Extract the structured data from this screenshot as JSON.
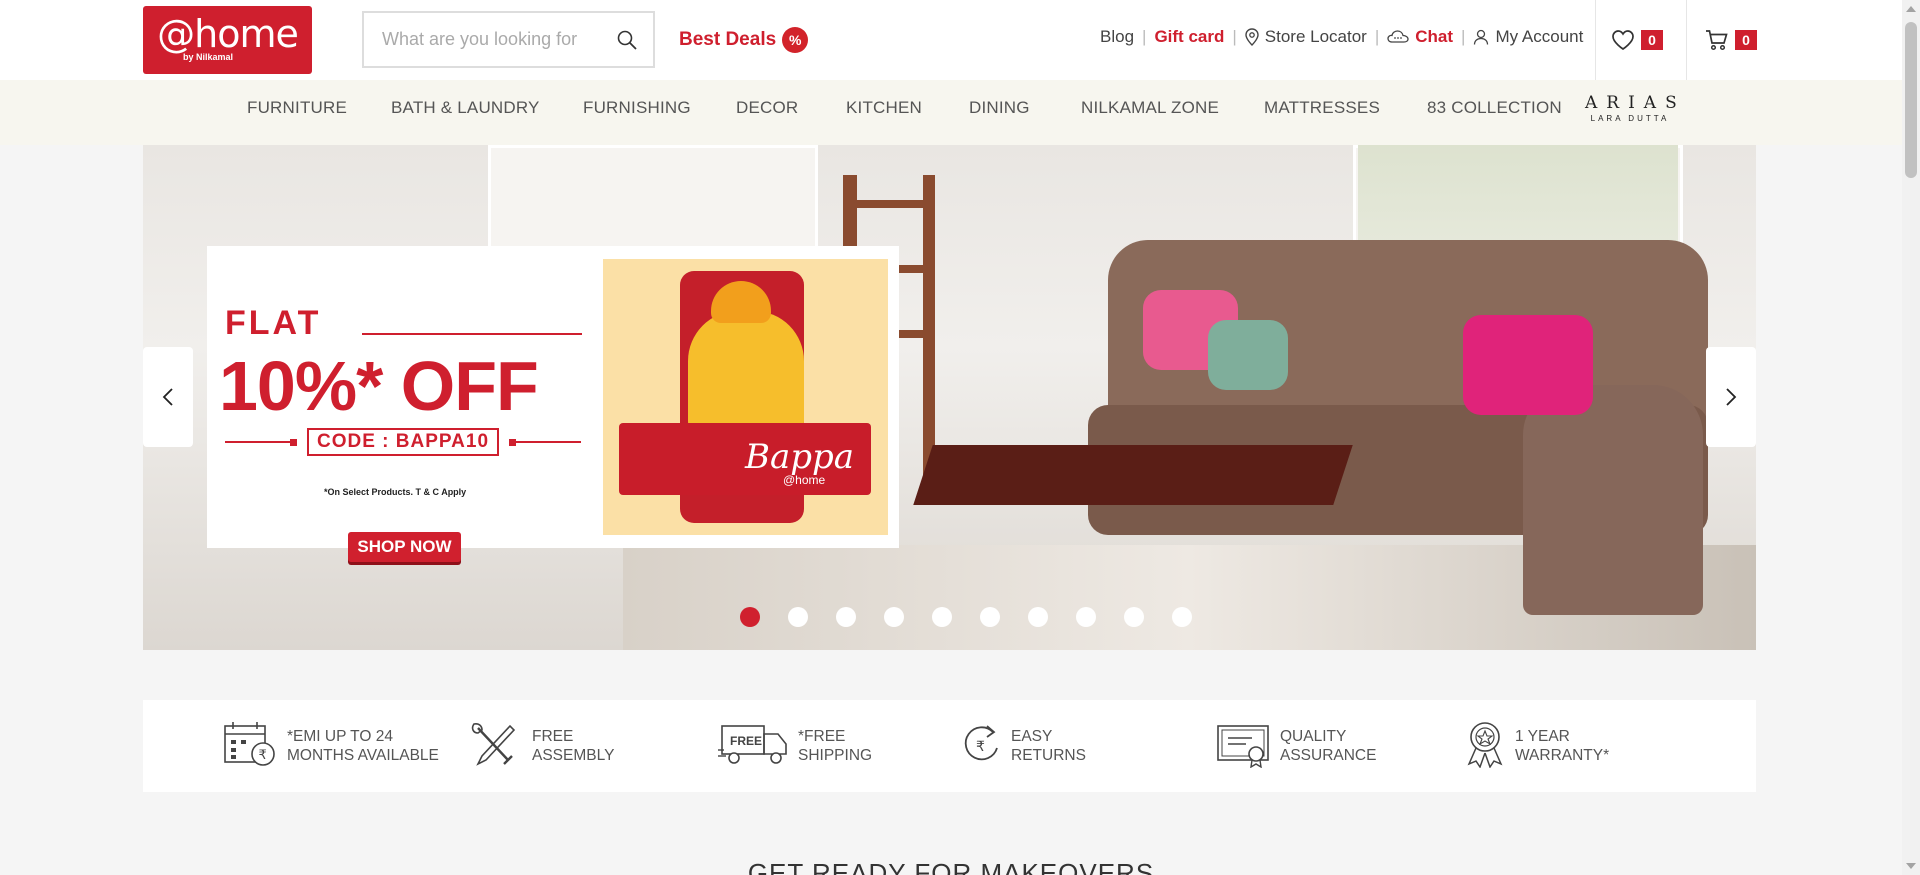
{
  "header": {
    "logo_text": "@home",
    "logo_sub": "by Nilkamal",
    "search_placeholder": "What are you looking for",
    "best_deals": "Best Deals",
    "best_deals_badge": "%",
    "links": {
      "blog": "Blog",
      "gift_card": "Gift card",
      "store_locator": "Store Locator",
      "chat": "Chat",
      "my_account": "My Account"
    },
    "wishlist_count": "0",
    "cart_count": "0"
  },
  "nav": {
    "items": [
      "FURNITURE",
      "BATH & LAUNDRY",
      "FURNISHING",
      "DECOR",
      "KITCHEN",
      "DINING",
      "NILKAMAL ZONE",
      "MATTRESSES",
      "83 COLLECTION"
    ],
    "arias_logo": "ARIAS",
    "arias_sub": "LARA DUTTA"
  },
  "hero": {
    "flat": "FLAT",
    "offer": "10%* OFF",
    "code": "CODE : BAPPA10",
    "terms": "*On Select Products. T & C Apply",
    "cta": "SHOP NOW",
    "bappa_text": "Bappa",
    "bappa_sub": "@home",
    "slide_count": 10,
    "active_slide": 1
  },
  "features": [
    {
      "icon": "calendar-rupee-icon",
      "line1": "*EMI UP TO 24",
      "line2": "MONTHS AVAILABLE"
    },
    {
      "icon": "tools-icon",
      "line1": "FREE",
      "line2": "ASSEMBLY"
    },
    {
      "icon": "free-truck-icon",
      "line1": "*FREE",
      "line2": "SHIPPING"
    },
    {
      "icon": "rupee-return-icon",
      "line1": "EASY",
      "line2": "RETURNS"
    },
    {
      "icon": "certificate-icon",
      "line1": "QUALITY",
      "line2": "ASSURANCE"
    },
    {
      "icon": "award-ribbon-icon",
      "line1": "1 YEAR",
      "line2": "WARRANTY*"
    }
  ],
  "section_title": "GET READY FOR MAKEOVERS",
  "colors": {
    "brand_red": "#cf1f2e",
    "nav_bg": "#f7f6ef",
    "page_bg": "#f5f5f5"
  }
}
